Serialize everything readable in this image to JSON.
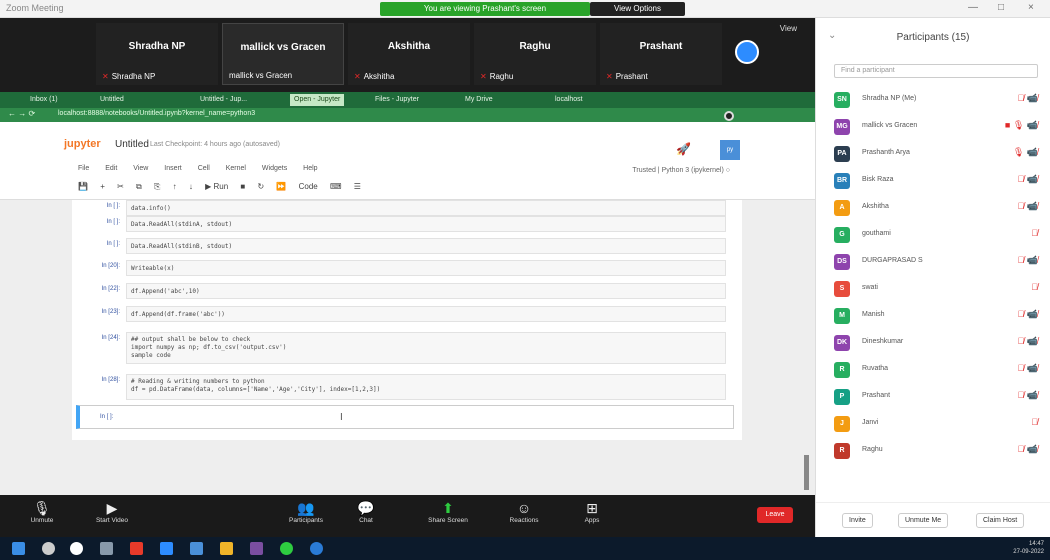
{
  "window": {
    "title": "Zoom Meeting",
    "share_banner": "You are viewing Prashant's screen",
    "stop_share": "View Options",
    "controls": [
      "—",
      "□",
      "×"
    ]
  },
  "video_tiles": [
    {
      "name": "Shradha NP",
      "sub": "Shradha NP"
    },
    {
      "name": "mallick vs Gracen",
      "sub": "mallick vs Gracen"
    },
    {
      "name": "Akshitha",
      "sub": "Akshitha"
    },
    {
      "name": "Raghu",
      "sub": "Raghu"
    },
    {
      "name": "Prashant",
      "sub": "Prashant"
    }
  ],
  "view_label": "View",
  "browser": {
    "tabs": [
      "Inbox (1)",
      "Untitled",
      "Untitled - Jup...",
      "Open - Jupyter",
      "Files - Jupyter",
      "My Drive",
      "localhost"
    ],
    "url": "localhost:8888/notebooks/Untitled.ipynb?kernel_name=python3",
    "nav": "← → ⟳"
  },
  "jupyter": {
    "brand": "jupyter",
    "title": "Untitled",
    "checkpoint": "Last Checkpoint: 4 hours ago (autosaved)",
    "menu": [
      "File",
      "Edit",
      "View",
      "Insert",
      "Cell",
      "Kernel",
      "Widgets",
      "Help"
    ],
    "toolbar": [
      "💾",
      "+",
      "✂",
      "⧉",
      "⎘",
      "↑",
      "↓",
      "▶ Run",
      "■",
      "↻",
      "⏩",
      "Code",
      "⌨",
      "☰"
    ],
    "kernel": "Trusted | Python 3 (ipykernel) ○",
    "python_logo": "py"
  },
  "cells": [
    {
      "prompt": "In [ ]:",
      "code": "data.info()"
    },
    {
      "prompt": "In [ ]:",
      "code": "Data.ReadAll(stdinA, stdout)"
    },
    {
      "prompt": "In [ ]:",
      "code": "Data.ReadAll(stdinB, stdout)"
    },
    {
      "prompt": "In [20]:",
      "code": "Writeable(x)"
    },
    {
      "prompt": "In [22]:",
      "code": "df.Append('abc',10)"
    },
    {
      "prompt": "In [23]:",
      "code": "df.Append(df.frame('abc'))"
    },
    {
      "prompt": "In [24]:",
      "code": "## output shall be below to check\nimport numpy as np; df.to_csv('output.csv')\nsample code"
    },
    {
      "prompt": "In [28]:",
      "code": "# Reading & writing numbers to python\ndf = pd.DataFrame(data, columns=['Name','Age','City'], index=[1,2,3])"
    }
  ],
  "active_cell_prompt": "In [ ]:",
  "meeting_controls": [
    {
      "label": "Unmute",
      "icon": "🎙"
    },
    {
      "label": "Start Video",
      "icon": "▶"
    },
    {
      "label": "Participants",
      "icon": "👥"
    },
    {
      "label": "Chat",
      "icon": "💬"
    },
    {
      "label": "Share Screen",
      "icon": "⬆"
    },
    {
      "label": "Reactions",
      "icon": "☺"
    },
    {
      "label": "Apps",
      "icon": "⊞"
    }
  ],
  "leave_label": "Leave",
  "participants": {
    "title": "Participants (15)",
    "search_placeholder": "Find a participant",
    "list": [
      {
        "initials": "SN",
        "name": "Shradha NP (Me)",
        "color": "#27ae60",
        "status": "🎙̸ 📹̸"
      },
      {
        "initials": "MG",
        "name": "mallick vs Gracen",
        "color": "#8e44ad",
        "status": "■ 🎙 📹̸"
      },
      {
        "initials": "PA",
        "name": "Prashanth Arya",
        "color": "#2c3e50",
        "status": "🎙 📹̸"
      },
      {
        "initials": "BR",
        "name": "Bisk Raza",
        "color": "#2980b9",
        "status": "🎙̸ 📹̸"
      },
      {
        "initials": "A",
        "name": "Akshitha",
        "color": "#f39c12",
        "status": "🎙̸ 📹̸"
      },
      {
        "initials": "G",
        "name": "gouthami",
        "color": "#27ae60",
        "status": "🎙̸"
      },
      {
        "initials": "DS",
        "name": "DURGAPRASAD S",
        "color": "#8e44ad",
        "status": "🎙̸ 📹̸"
      },
      {
        "initials": "S",
        "name": "swati",
        "color": "#e74c3c",
        "status": "🎙̸"
      },
      {
        "initials": "M",
        "name": "Manish",
        "color": "#27ae60",
        "status": "🎙̸ 📹̸"
      },
      {
        "initials": "DK",
        "name": "Dineshkumar",
        "color": "#8e44ad",
        "status": "🎙̸ 📹̸"
      },
      {
        "initials": "R",
        "name": "Ruvatha",
        "color": "#27ae60",
        "status": "🎙̸ 📹̸"
      },
      {
        "initials": "P",
        "name": "Prashant",
        "color": "#16a085",
        "status": "🎙̸ 📹̸"
      },
      {
        "initials": "J",
        "name": "Janvi",
        "color": "#f39c12",
        "status": "🎙̸"
      },
      {
        "initials": "R",
        "name": "Raghu",
        "color": "#c0392b",
        "status": "🎙̸ 📹̸"
      }
    ],
    "footer": [
      "Invite",
      "Unmute Me",
      "Claim Host"
    ]
  },
  "clock": {
    "time": "14:47",
    "date": "27-09-2022"
  }
}
